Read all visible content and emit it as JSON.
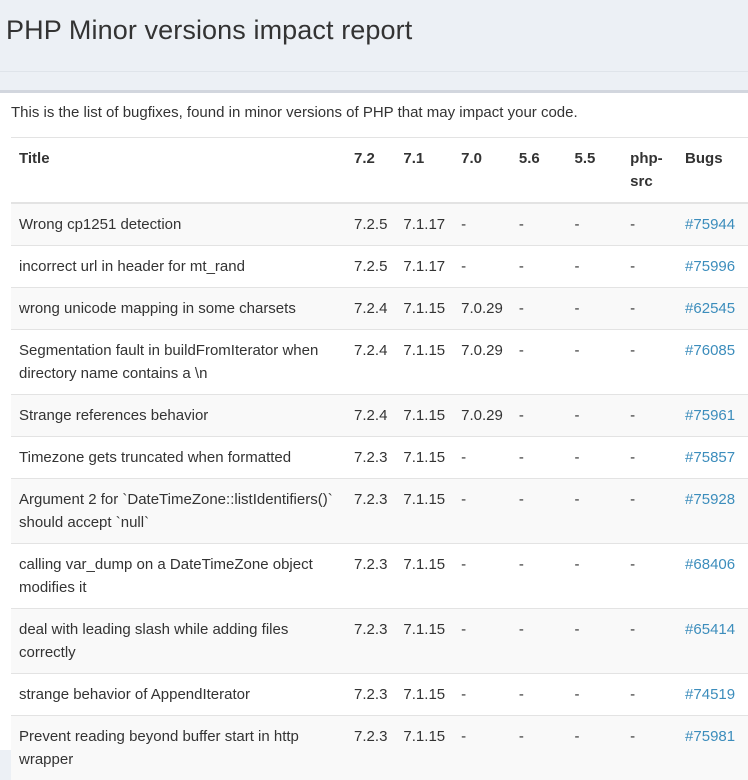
{
  "header": {
    "title": "PHP Minor versions impact report"
  },
  "intro": {
    "text": "This is the list of bugfixes, found in minor versions of PHP that may impact your code."
  },
  "table": {
    "columns": [
      "Title",
      "7.2",
      "7.1",
      "7.0",
      "5.6",
      "5.5",
      "php-src",
      "Bugs"
    ],
    "rows": [
      [
        "Wrong cp1251 detection",
        "7.2.5",
        "7.1.17",
        "-",
        "-",
        "-",
        "-",
        "#75944"
      ],
      [
        "incorrect url in header for mt_rand",
        "7.2.5",
        "7.1.17",
        "-",
        "-",
        "-",
        "-",
        "#75996"
      ],
      [
        "wrong unicode mapping in some charsets",
        "7.2.4",
        "7.1.15",
        "7.0.29",
        "-",
        "-",
        "-",
        "#62545"
      ],
      [
        "Segmentation fault in buildFromIterator when directory name contains a \\n",
        "7.2.4",
        "7.1.15",
        "7.0.29",
        "-",
        "-",
        "-",
        "#76085"
      ],
      [
        "Strange references behavior",
        "7.2.4",
        "7.1.15",
        "7.0.29",
        "-",
        "-",
        "-",
        "#75961"
      ],
      [
        "Timezone gets truncated when formatted",
        "7.2.3",
        "7.1.15",
        "-",
        "-",
        "-",
        "-",
        "#75857"
      ],
      [
        "Argument 2 for `DateTimeZone::listIdentifiers()` should accept `null`",
        "7.2.3",
        "7.1.15",
        "-",
        "-",
        "-",
        "-",
        "#75928"
      ],
      [
        "calling var_dump on a DateTimeZone object modifies it",
        "7.2.3",
        "7.1.15",
        "-",
        "-",
        "-",
        "-",
        "#68406"
      ],
      [
        "deal with leading slash while adding files correctly",
        "7.2.3",
        "7.1.15",
        "-",
        "-",
        "-",
        "-",
        "#65414"
      ],
      [
        "strange behavior of AppendIterator",
        "7.2.3",
        "7.1.15",
        "-",
        "-",
        "-",
        "-",
        "#74519"
      ],
      [
        "Prevent reading beyond buffer start in http wrapper",
        "7.2.3",
        "7.1.15",
        "-",
        "-",
        "-",
        "-",
        "#75981"
      ]
    ]
  },
  "colors": {
    "background": "#ecf0f5",
    "link": "#3c8dbc",
    "text": "#333333"
  }
}
